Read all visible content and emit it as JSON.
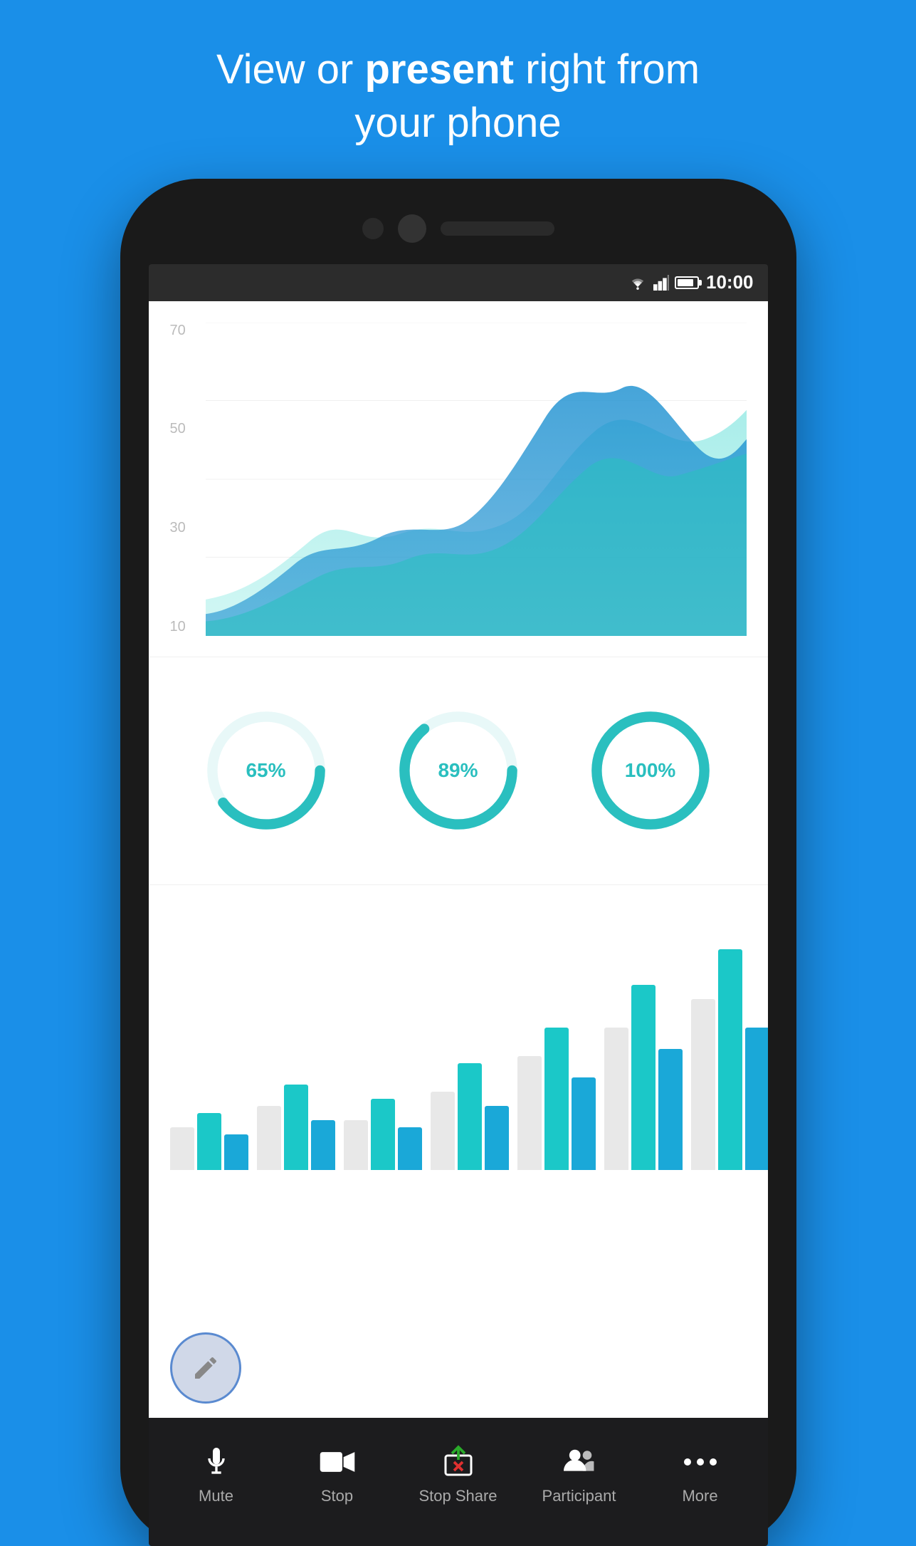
{
  "header": {
    "line1": "View or ",
    "highlight": "present",
    "line2": " right from",
    "line3": "your phone"
  },
  "status_bar": {
    "time": "10:00"
  },
  "chart": {
    "y_labels": [
      "70",
      "50",
      "30",
      "10"
    ]
  },
  "donuts": [
    {
      "percent": "65%",
      "value": 65
    },
    {
      "percent": "89%",
      "value": 89
    },
    {
      "percent": "100%",
      "value": 100
    }
  ],
  "toolbar": {
    "items": [
      {
        "icon": "mic-icon",
        "label": "Mute"
      },
      {
        "icon": "video-icon",
        "label": "Stop"
      },
      {
        "icon": "stop-share-icon",
        "label": "Stop Share"
      },
      {
        "icon": "participant-icon",
        "label": "Participant"
      },
      {
        "icon": "more-icon",
        "label": "More"
      }
    ]
  }
}
